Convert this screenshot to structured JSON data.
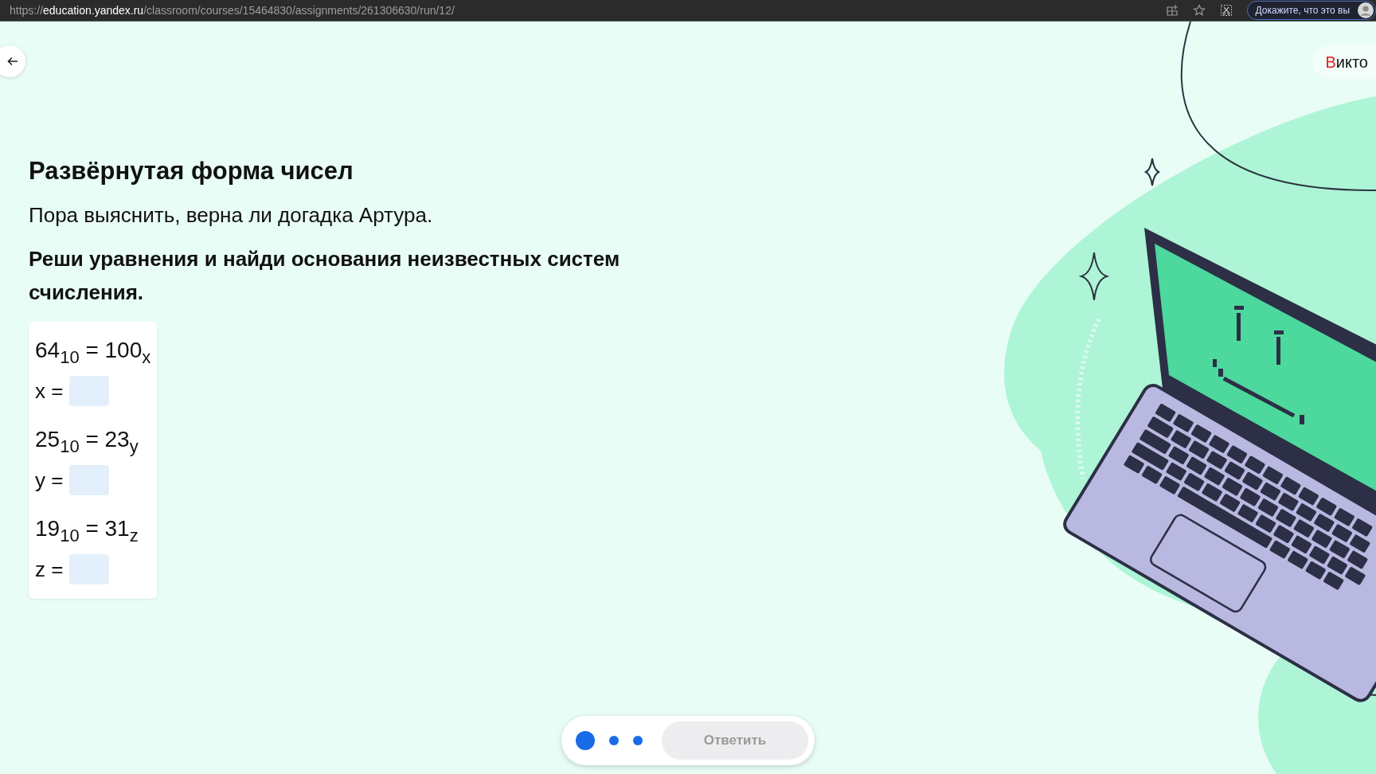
{
  "browser": {
    "url": {
      "scheme": "https://",
      "host": "education.yandex.ru",
      "path": "/classroom/courses/15464830/assignments/261306630/run/12/"
    },
    "profile_button": "Докажите, что это вы"
  },
  "user_chip": "Викто",
  "task": {
    "title": "Развёрнутая форма чисел",
    "intro": "Пора выяснить, верна ли догадка Артура.",
    "instruction": "Реши уравнения и найди основания неизвестных систем счисления.",
    "equations": [
      {
        "equation": "64$_{10}$ = 100$_{x}$",
        "label": "x ="
      },
      {
        "equation": "25$_{10}$ = 23$_{y}$",
        "label": "y ="
      },
      {
        "equation": "19$_{10}$ = 31$_{z}$",
        "label": "z ="
      }
    ]
  },
  "steps": [
    {
      "selected": true
    },
    {
      "selected": false
    },
    {
      "selected": false
    }
  ],
  "answer_button": {
    "label": "Ответить",
    "disabled": true
  }
}
